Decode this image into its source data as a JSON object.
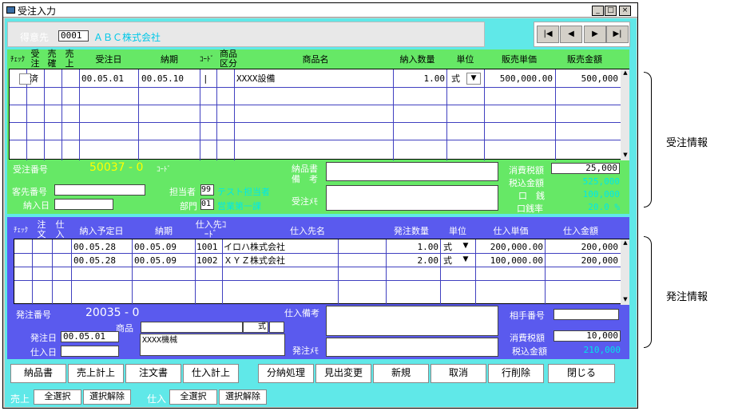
{
  "window": {
    "title": "受注入力",
    "min": "_",
    "max": "□",
    "close": "×"
  },
  "header": {
    "customer_label": "得意先",
    "customer_code": "0001",
    "customer_name": "ＡＢＣ株式会社"
  },
  "nav": {
    "first": "|◀",
    "prev": "◀",
    "next": "▶",
    "last": "▶|"
  },
  "order": {
    "columns": [
      "ﾁｪｯｸ",
      "受注",
      "売確",
      "売上",
      "受注日",
      "納期",
      "ｺｰﾄﾞ",
      "商品区分",
      "商品名",
      "納入数量",
      "単位",
      "販売単価",
      "販売金額"
    ],
    "rows": [
      {
        "status": "済",
        "date": "00.05.01",
        "due": "00.05.10",
        "code": "|",
        "product": "XXXX設備",
        "qty": "1.00",
        "unit": "式",
        "price": "500,000.00",
        "amount": "500,000"
      }
    ],
    "no_label": "受注番号",
    "no": "50037 - 0",
    "code_label": "ｺｰﾄﾞ",
    "client_no_label": "客先番号",
    "delivery_label": "納入日",
    "staff_label": "担当者",
    "staff_code": "99",
    "staff_name": "テスト担当者",
    "dept_label": "部門",
    "dept_code": "01",
    "dept_name": "営業第一課",
    "deliv_note_label": "納品書",
    "remarks_label": "備　考",
    "memo_label": "受注ﾒﾓ",
    "tax_label": "消費税額",
    "tax": "25,000",
    "total_label": "税込金額",
    "total": "525,000",
    "margin_label": "口　銭",
    "margin": "100,000",
    "margin_rate_label": "口銭率",
    "margin_rate": "20.0 %"
  },
  "purchase": {
    "columns": [
      "ﾁｪｯｸ",
      "注文",
      "仕入",
      "納入予定日",
      "納期",
      "仕入先ｺｰﾄﾞ",
      "仕入先名",
      "発注数量",
      "単位",
      "仕入単価",
      "仕入金額"
    ],
    "rows": [
      {
        "date": "00.05.28",
        "due": "00.05.09",
        "code": "1001",
        "name": "イロハ株式会社",
        "qty": "1.00",
        "unit": "式",
        "price": "200,000.00",
        "amount": "200,000"
      },
      {
        "date": "00.05.28",
        "due": "00.05.09",
        "code": "1002",
        "name": "ＸＹＺ株式会社",
        "qty": "2.00",
        "unit": "式",
        "price": "100,000.00",
        "amount": "200,000"
      }
    ],
    "no_label": "発注番号",
    "no": "20035 - 0",
    "product_label": "商品",
    "unit": "式",
    "product_name": "XXXX機械",
    "order_date_label": "発注日",
    "order_date": "00.05.01",
    "purchase_date_label": "仕入日",
    "remarks_label": "仕入備考",
    "memo_label": "発注ﾒﾓ",
    "partner_label": "相手番号",
    "tax_label": "消費税額",
    "tax": "10,000",
    "total_label": "税込金額",
    "total": "210,000"
  },
  "buttons": [
    "納品書",
    "売上計上",
    "注文書",
    "仕入計上",
    "分納処理",
    "見出変更",
    "新規",
    "取消",
    "行削除",
    "閉じる"
  ],
  "footer": {
    "sales_label": "売上",
    "select_all": "全選択",
    "deselect": "選択解除",
    "purchase_label": "仕入",
    "select_all2": "全選択",
    "deselect2": "選択解除"
  },
  "annotations": {
    "order_info": "受注情報",
    "purchase_info": "発注情報"
  }
}
